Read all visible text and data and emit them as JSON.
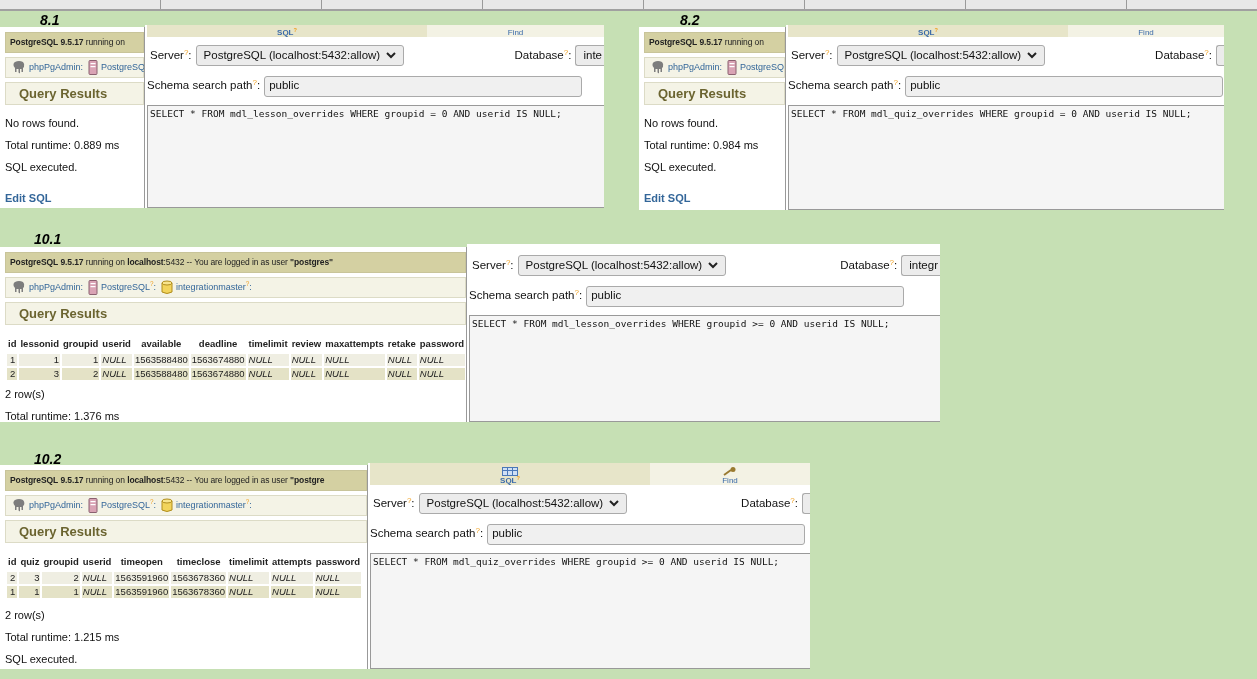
{
  "snapshots": [
    {
      "label": "8.1",
      "results": {
        "status": "**PostgreSQL** **9.5.17** running on",
        "breadcrumb": [
          {
            "text": "phpPgAdmin:"
          },
          {
            "text": "PostgreSQ"
          }
        ],
        "title": "Query Results",
        "messages": [
          "No rows found.",
          "Total runtime: 0.889 ms",
          "SQL executed."
        ],
        "link": "Edit SQL"
      },
      "editor": {
        "tabs": [
          {
            "label": "SQL$^{?}$",
            "selected": true
          },
          {
            "label": "Find",
            "selected": false
          }
        ],
        "server_label": "Server$^{?}$:",
        "server": "PostgreSQL (localhost:5432:allow)",
        "database_label": "Database$^{?}$:",
        "database": "inte",
        "schema_label": "Schema search path$^{?}$:",
        "schema": "public",
        "sql": "SELECT * FROM mdl_lesson_overrides WHERE groupid = 0 AND userid IS NULL;"
      }
    },
    {
      "label": "8.2",
      "results": {
        "status": "**PostgreSQL** **9.5.17** running on",
        "breadcrumb": [
          {
            "text": "phpPgAdmin:"
          },
          {
            "text": "PostgreSQ"
          }
        ],
        "title": "Query Results",
        "messages": [
          "No rows found.",
          "Total runtime: 0.984 ms",
          "SQL executed."
        ],
        "link": "Edit SQL"
      },
      "editor": {
        "tabs": [
          {
            "label": "SQL$^{?}$",
            "selected": true
          },
          {
            "label": "Find",
            "selected": false
          }
        ],
        "server_label": "Server$^{?}$:",
        "server": "PostgreSQL (localhost:5432:allow)",
        "database_label": "Database$^{?}$:",
        "schema_label": "Schema search path$^{?}$:",
        "schema": "public",
        "sql": "SELECT * FROM mdl_quiz_overrides WHERE groupid = 0 AND userid IS NULL;"
      }
    },
    {
      "label": "10.1",
      "results": {
        "status": "**PostgreSQL** **9.5.17** running on **localhost**:5432 -- You are logged in as user **\"postgres\"**",
        "breadcrumb": [
          {
            "text": "phpPgAdmin:"
          },
          {
            "text": "PostgreSQL$^{?}$:"
          },
          {
            "text": "integrationmaster$^{?}$:"
          }
        ],
        "title": "Query Results",
        "table": {
          "columns": [
            {
              "label": "id",
              "kind": "id"
            },
            {
              "label": "lessonid",
              "kind": "number"
            },
            {
              "label": "groupid",
              "kind": "number"
            },
            {
              "label": "userid",
              "kind": "null"
            },
            {
              "label": "available",
              "kind": "text"
            },
            {
              "label": "deadline",
              "kind": "text"
            },
            {
              "label": "timelimit",
              "kind": "null"
            },
            {
              "label": "review",
              "kind": "null"
            },
            {
              "label": "maxattempts",
              "kind": "null"
            },
            {
              "label": "retake",
              "kind": "null"
            },
            {
              "label": "password",
              "kind": "null"
            }
          ],
          "rows": [
            [
              "1",
              "1",
              "1",
              "NULL",
              "1563588480",
              "1563674880",
              "NULL",
              "NULL",
              "NULL",
              "NULL",
              "NULL"
            ],
            [
              "2",
              "3",
              "2",
              "NULL",
              "1563588480",
              "1563674880",
              "NULL",
              "NULL",
              "NULL",
              "NULL",
              "NULL"
            ]
          ]
        },
        "messages": [
          "2 row(s)",
          "Total runtime: 1.376 ms"
        ]
      },
      "editor": {
        "server_label": "Server$^{?}$:",
        "server": "PostgreSQL (localhost:5432:allow)",
        "database_label": "Database$^{?}$:",
        "database": "integr",
        "schema_label": "Schema search path$^{?}$:",
        "schema": "public",
        "sql": "SELECT * FROM mdl_lesson_overrides WHERE groupid >= 0 AND userid IS NULL;"
      }
    },
    {
      "label": "10.2",
      "results": {
        "status": "**PostgreSQL** **9.5.17** running on **localhost**:5432 -- You are logged in as user **\"postgre**",
        "breadcrumb": [
          {
            "text": "phpPgAdmin:"
          },
          {
            "text": "PostgreSQL$^{?}$:"
          },
          {
            "text": "integrationmaster$^{?}$:"
          }
        ],
        "title": "Query Results",
        "table": {
          "columns": [
            {
              "label": "id",
              "kind": "id"
            },
            {
              "label": "quiz",
              "kind": "number"
            },
            {
              "label": "groupid",
              "kind": "number"
            },
            {
              "label": "userid",
              "kind": "null"
            },
            {
              "label": "timeopen",
              "kind": "text"
            },
            {
              "label": "timeclose",
              "kind": "text"
            },
            {
              "label": "timelimit",
              "kind": "null"
            },
            {
              "label": "attempts",
              "kind": "null"
            },
            {
              "label": "password",
              "kind": "null"
            }
          ],
          "rows": [
            [
              "2",
              "3",
              "2",
              "NULL",
              "1563591960",
              "1563678360",
              "NULL",
              "NULL",
              "NULL"
            ],
            [
              "1",
              "1",
              "1",
              "NULL",
              "1563591960",
              "1563678360",
              "NULL",
              "NULL",
              "NULL"
            ]
          ]
        },
        "messages": [
          "2 row(s)",
          "Total runtime: 1.215 ms",
          "SQL executed."
        ]
      },
      "editor": {
        "tabs": [
          {
            "label": "SQL$^{?}$",
            "selected": true
          },
          {
            "label": "Find",
            "selected": false
          }
        ],
        "server_label": "Server$^{?}$:",
        "server": "PostgreSQL (localhost:5432:allow)",
        "database_label": "Database$^{?}$:",
        "schema_label": "Schema search path$^{?}$:",
        "schema": "public",
        "sql": "SELECT * FROM mdl_quiz_overrides WHERE groupid >= 0 AND userid IS NULL;"
      }
    }
  ]
}
